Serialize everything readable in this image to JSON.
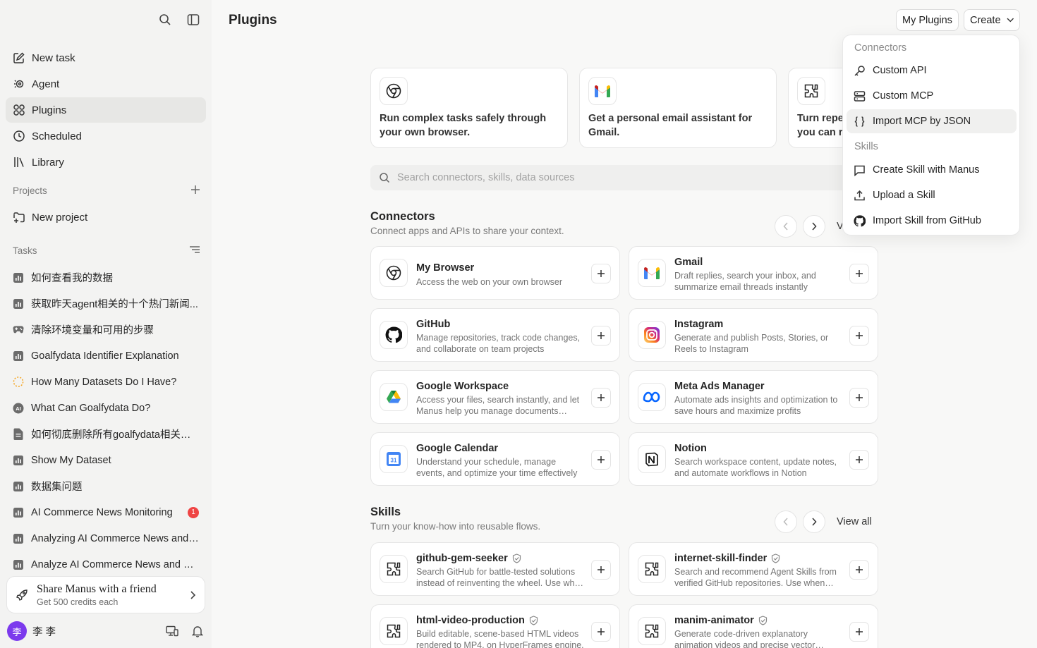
{
  "sidebar": {
    "nav": [
      {
        "label": "New task",
        "icon": "new-task-icon"
      },
      {
        "label": "Agent",
        "icon": "agent-icon"
      },
      {
        "label": "Plugins",
        "icon": "plugins-icon",
        "active": true
      },
      {
        "label": "Scheduled",
        "icon": "clock-icon"
      },
      {
        "label": "Library",
        "icon": "library-icon"
      }
    ],
    "projects_label": "Projects",
    "new_project": "New project",
    "tasks_label": "Tasks",
    "tasks": [
      {
        "title": "如何查看我的数据",
        "icon": "chart-icon"
      },
      {
        "title": "获取昨天agent相关的十个热门新闻...",
        "icon": "chart-icon"
      },
      {
        "title": "清除环境变量和可用的步骤",
        "icon": "gamepad-icon"
      },
      {
        "title": "Goalfydata Identifier Explanation",
        "icon": "chart-icon"
      },
      {
        "title": "How Many Datasets Do I Have?",
        "icon": "loading-icon"
      },
      {
        "title": "What Can Goalfydata Do?",
        "icon": "ai-icon"
      },
      {
        "title": "如何彻底删除所有goalfydata相关信息",
        "icon": "document-icon"
      },
      {
        "title": "Show My Dataset",
        "icon": "chart-icon"
      },
      {
        "title": "数据集问题",
        "icon": "chart-icon"
      },
      {
        "title": "AI Commerce News Monitoring",
        "icon": "chart-icon",
        "badge": "1"
      },
      {
        "title": "Analyzing AI Commerce News and Trends",
        "icon": "chart-icon"
      },
      {
        "title": "Analyze AI Commerce News and Content",
        "icon": "chart-icon"
      }
    ],
    "share": {
      "title": "Share Manus with a friend",
      "subtitle": "Get 500 credits each"
    },
    "user": {
      "initial": "李",
      "name": "李 李"
    }
  },
  "header": {
    "title": "Plugins",
    "my_plugins": "My Plugins",
    "create": "Create"
  },
  "featured": [
    {
      "text": "Run complex tasks safely through your own browser.",
      "icon": "chrome-icon"
    },
    {
      "text": "Get a personal email assistant for Gmail.",
      "icon": "gmail-icon"
    },
    {
      "text": "Turn repeated workflows into skills you can reuse.",
      "icon": "skill-icon"
    }
  ],
  "search": {
    "placeholder": "Search connectors, skills, data sources"
  },
  "connectors": {
    "title": "Connectors",
    "subtitle": "Connect apps and APIs to share your context.",
    "view_all": "View all",
    "items": [
      {
        "name": "My Browser",
        "desc": "Access the web on your own browser",
        "icon": "chrome-icon"
      },
      {
        "name": "Gmail",
        "desc": "Draft replies, search your inbox, and summarize email threads instantly",
        "icon": "gmail-icon"
      },
      {
        "name": "GitHub",
        "desc": "Manage repositories, track code changes, and collaborate on team projects",
        "icon": "github-icon"
      },
      {
        "name": "Instagram",
        "desc": "Generate and publish Posts, Stories, or Reels to Instagram",
        "icon": "instagram-icon"
      },
      {
        "name": "Google Workspace",
        "desc": "Access your files, search instantly, and let Manus help you manage documents intelligently",
        "icon": "google-drive-icon"
      },
      {
        "name": "Meta Ads Manager",
        "desc": "Automate ads insights and optimization to save hours and maximize profits",
        "icon": "meta-icon"
      },
      {
        "name": "Google Calendar",
        "desc": "Understand your schedule, manage events, and optimize your time effectively",
        "icon": "google-calendar-icon"
      },
      {
        "name": "Notion",
        "desc": "Search workspace content, update notes, and automate workflows in Notion",
        "icon": "notion-icon"
      }
    ]
  },
  "skills": {
    "title": "Skills",
    "subtitle": "Turn your know-how into reusable flows.",
    "view_all": "View all",
    "items": [
      {
        "name": "github-gem-seeker",
        "desc": "Search GitHub for battle-tested solutions instead of reinventing the wheel. Use when users need proven tools.",
        "icon": "skill-icon"
      },
      {
        "name": "internet-skill-finder",
        "desc": "Search and recommend Agent Skills from verified GitHub repositories. Use when users ask for skills.",
        "icon": "skill-icon"
      },
      {
        "name": "html-video-production",
        "desc": "Build editable, scene-based HTML videos rendered to MP4, on HyperFrames engine.",
        "icon": "skill-icon"
      },
      {
        "name": "manim-animator",
        "desc": "Generate code-driven explanatory animation videos and precise vector graphics.",
        "icon": "skill-icon"
      }
    ]
  },
  "create_menu": {
    "connectors_label": "Connectors",
    "skills_label": "Skills",
    "items": [
      {
        "label": "Custom API",
        "icon": "key-icon"
      },
      {
        "label": "Custom MCP",
        "icon": "server-icon"
      },
      {
        "label": "Import MCP by JSON",
        "icon": "braces-icon"
      },
      {
        "label": "Create Skill with Manus",
        "icon": "chat-icon"
      },
      {
        "label": "Upload a Skill",
        "icon": "upload-icon"
      },
      {
        "label": "Import Skill from GitHub",
        "icon": "github-icon"
      }
    ]
  },
  "colors": {
    "accent": "#7c3aed",
    "badge": "#ef4444"
  }
}
